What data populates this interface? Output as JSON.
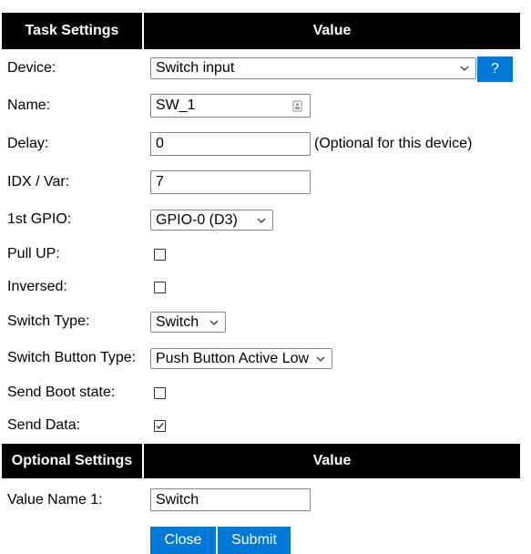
{
  "headers": {
    "task_settings": "Task Settings",
    "value": "Value",
    "optional_settings": "Optional Settings",
    "optional_value": "Value"
  },
  "device": {
    "label": "Device:",
    "selected": "Switch input",
    "help_label": "?"
  },
  "name": {
    "label": "Name:",
    "value": "SW_1"
  },
  "delay": {
    "label": "Delay:",
    "value": "0",
    "note": "(Optional for this device)"
  },
  "idx": {
    "label": "IDX / Var:",
    "value": "7"
  },
  "gpio": {
    "label": "1st GPIO:",
    "selected": "GPIO-0 (D3)"
  },
  "pull_up": {
    "label": "Pull UP:",
    "checked": false
  },
  "inversed": {
    "label": "Inversed:",
    "checked": false
  },
  "switch_type": {
    "label": "Switch Type:",
    "selected": "Switch"
  },
  "switch_button_type": {
    "label": "Switch Button Type:",
    "selected": "Push Button Active Low"
  },
  "send_boot_state": {
    "label": "Send Boot state:",
    "checked": false
  },
  "send_data": {
    "label": "Send Data:",
    "checked": true
  },
  "value_name_1": {
    "label": "Value Name 1:",
    "value": "Switch"
  },
  "actions": {
    "close_label": "Close",
    "submit_label": "Submit"
  },
  "colors": {
    "header_bg": "#000000",
    "button_bg": "#0078d7"
  }
}
